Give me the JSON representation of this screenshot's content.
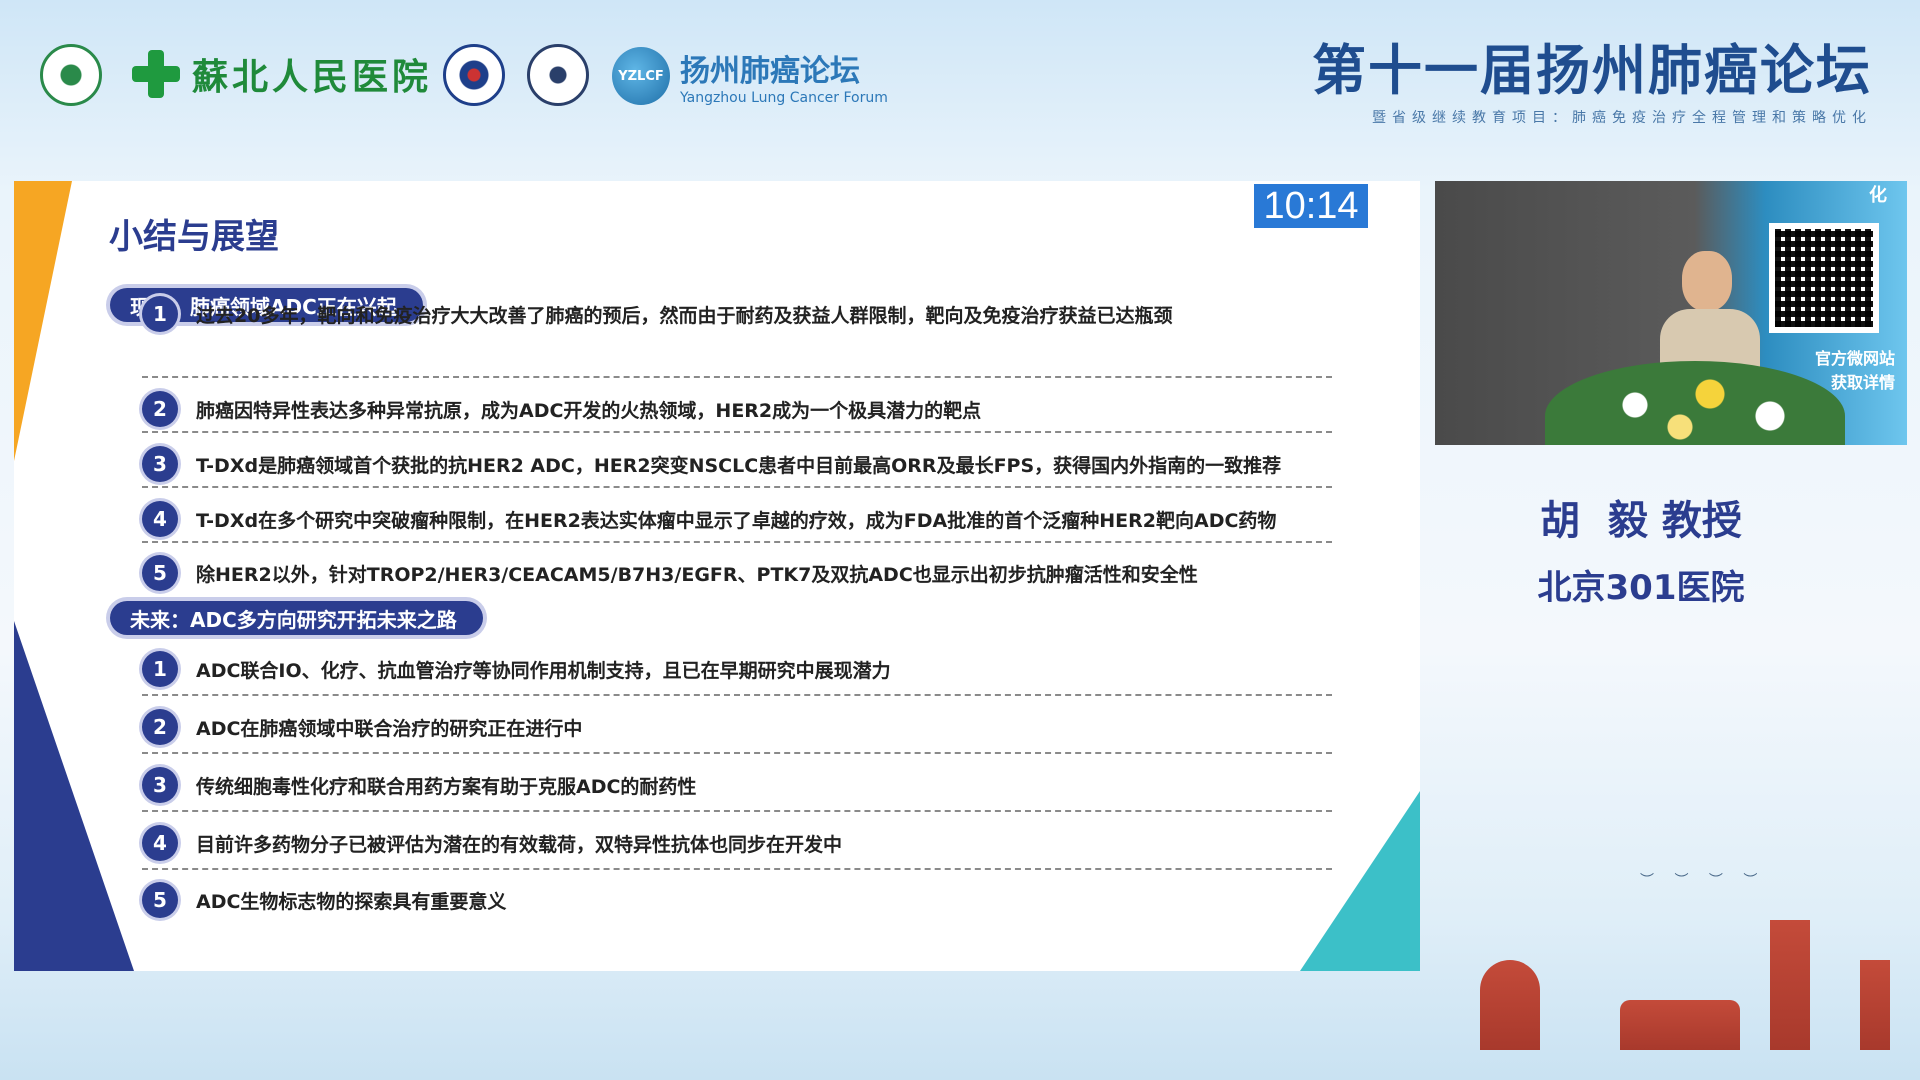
{
  "header": {
    "hospital_name": "蘇北人民医院",
    "forum_cn": "扬州肺癌论坛",
    "forum_en": "Yangzhou Lung Cancer Forum",
    "forum_abbr": "YZLCF",
    "event_title": "第十一届扬州肺癌论坛",
    "event_subtitle": "暨省级继续教育项目：肺癌免疫治疗全程管理和策略优化"
  },
  "slide": {
    "title": "小结与展望",
    "timer": "10:14",
    "sections": [
      {
        "label": "现状：肺癌领域ADC正在兴起",
        "items": [
          {
            "num": "1",
            "text": "过去20多年，靶向和免疫治疗大大改善了肺癌的预后，然而由于耐药及获益人群限制，靶向及免疫治疗获益已达瓶颈"
          },
          {
            "num": "2",
            "text": "肺癌因特异性表达多种异常抗原，成为ADC开发的火热领域，HER2成为一个极具潜力的靶点"
          },
          {
            "num": "3",
            "text": "T-DXd是肺癌领域首个获批的抗HER2 ADC，HER2突变NSCLC患者中目前最高ORR及最长FPS，获得国内外指南的一致推荐"
          },
          {
            "num": "4",
            "text": "T-DXd在多个研究中突破瘤种限制，在HER2表达实体瘤中显示了卓越的疗效，成为FDA批准的首个泛瘤种HER2靶向ADC药物"
          },
          {
            "num": "5",
            "text": "除HER2以外，针对TROP2/HER3/CEACAM5/B7H3/EGFR、PTK7及双抗ADC也显示出初步抗肿瘤活性和安全性"
          }
        ]
      },
      {
        "label": "未来：ADC多方向研究开拓未来之路",
        "items": [
          {
            "num": "1",
            "text": "ADC联合IO、化疗、抗血管治疗等协同作用机制支持，且已在早期研究中展现潜力"
          },
          {
            "num": "2",
            "text": "ADC在肺癌领域中联合治疗的研究正在进行中"
          },
          {
            "num": "3",
            "text": "传统细胞毒性化疗和联合用药方案有助于克服ADC的耐药性"
          },
          {
            "num": "4",
            "text": "目前许多药物分子已被评估为潜在的有效载荷，双特异性抗体也同步在开发中"
          },
          {
            "num": "5",
            "text": "ADC生物标志物的探索具有重要意义"
          }
        ]
      }
    ]
  },
  "video": {
    "screen_text_1": "官方微网站",
    "screen_text_2": "获取详情",
    "screen_corner": "化"
  },
  "speaker": {
    "name": "胡  毅 教授",
    "hospital": "北京301医院"
  },
  "colors": {
    "primary": "#2b3d8f",
    "accent_orange": "#f6a623",
    "accent_teal": "#3cc0c8",
    "timer_blue": "#2979d6"
  }
}
